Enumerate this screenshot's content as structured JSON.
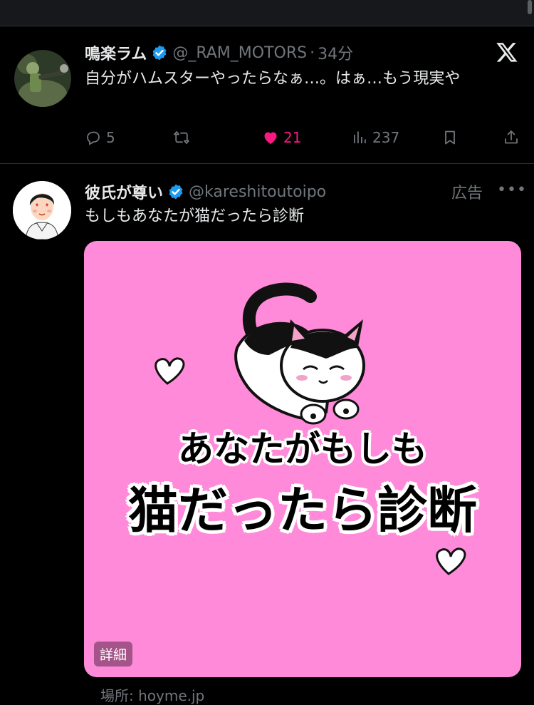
{
  "tweet1": {
    "display_name": "鳴楽ラム",
    "handle": "@_RAM_MOTORS",
    "separator": "·",
    "time": "34分",
    "text": "自分がハムスターやったらなぁ…。はぁ…もう現実や",
    "actions": {
      "reply_count": "5",
      "like_count": "21",
      "view_count": "237"
    }
  },
  "tweet2": {
    "display_name": "彼氏が尊い",
    "handle": "@kareshitoutoipo",
    "ad_label": "広告",
    "text": "もしもあなたが猫だったら診断",
    "media": {
      "line1": "あなたがもしも",
      "line2": "猫だったら診断",
      "details_label": "詳細"
    },
    "location": "場所: hoyme.jp"
  },
  "colors": {
    "background": "#000000",
    "text": "#e7e9ea",
    "secondary": "#71767b",
    "like": "#f91880",
    "verified": "#1d9bf0",
    "media_bg": "#ff8ad9"
  },
  "icons": [
    "x-logo-icon",
    "verified-badge-icon",
    "reply-icon",
    "retweet-icon",
    "heart-icon",
    "views-icon",
    "bookmark-icon",
    "share-icon",
    "more-icon",
    "heart-decoration-icon",
    "cat-illustration"
  ]
}
